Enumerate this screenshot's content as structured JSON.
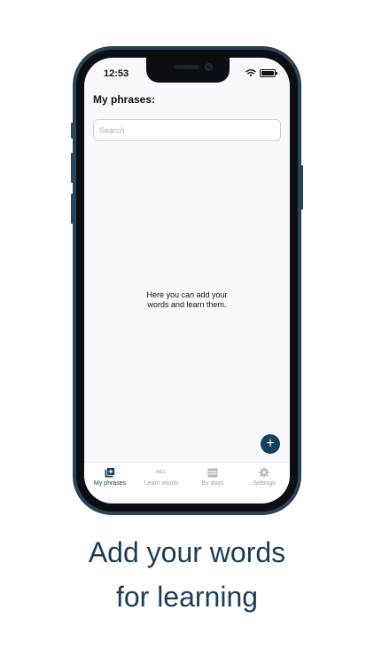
{
  "status_bar": {
    "time": "12:53"
  },
  "header": {
    "title": "My phrases:"
  },
  "search": {
    "placeholder": "Search",
    "value": ""
  },
  "empty_state": {
    "line1": "Here you can add your",
    "line2": "words and learn them."
  },
  "fab": {
    "label": "+"
  },
  "tabs": [
    {
      "label": "My phrases",
      "icon": "add-card-icon",
      "active": true
    },
    {
      "label": "Learn words",
      "icon": "rec-icon",
      "icon_text": "REC",
      "active": false
    },
    {
      "label": "By days",
      "icon": "calendar-icon",
      "active": false
    },
    {
      "label": "Settings",
      "icon": "gear-icon",
      "active": false
    }
  ],
  "caption": {
    "line1": "Add your words",
    "line2": "for learning"
  },
  "colors": {
    "accent": "#12405e",
    "caption": "#1b3d58",
    "phone_frame": "#2b4456",
    "screen_bg": "#f9f8fd"
  }
}
